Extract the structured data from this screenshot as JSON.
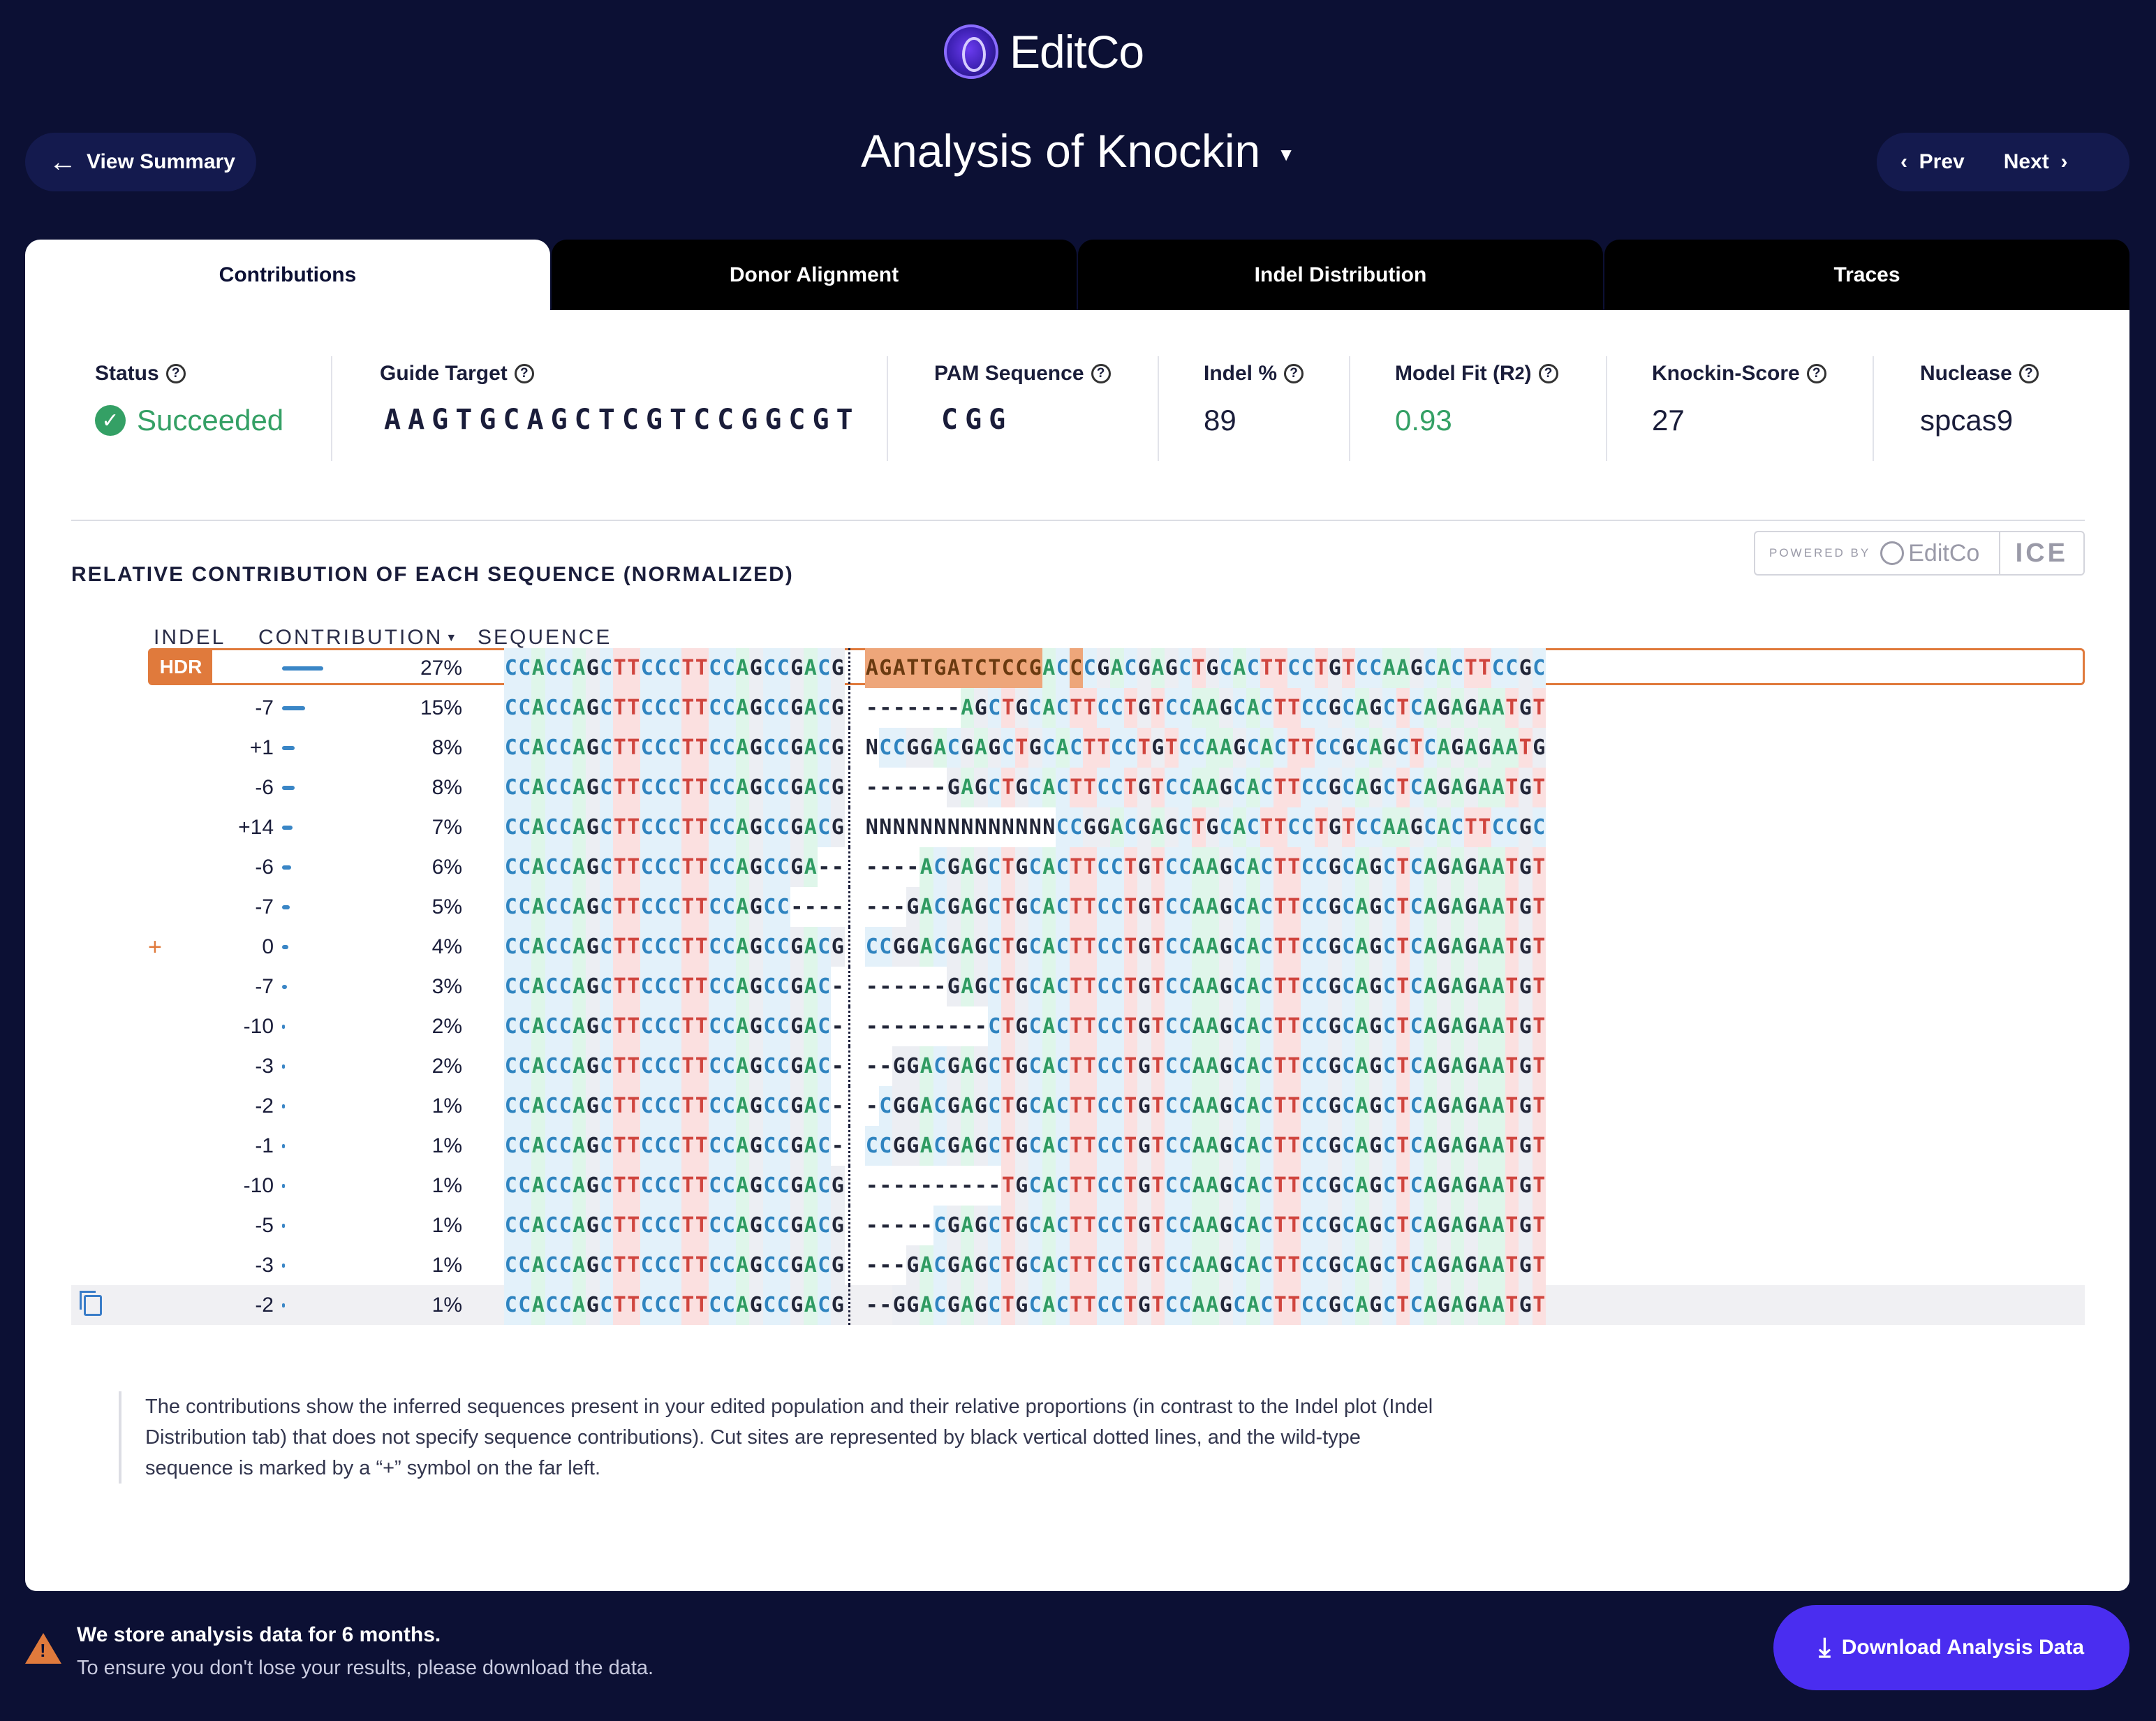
{
  "brand": {
    "name": "EditCo"
  },
  "header": {
    "title": "Analysis of Knockin",
    "view_summary": "View Summary",
    "prev": "Prev",
    "next": "Next"
  },
  "tabs": [
    {
      "label": "Contributions",
      "active": true
    },
    {
      "label": "Donor Alignment",
      "active": false
    },
    {
      "label": "Indel Distribution",
      "active": false
    },
    {
      "label": "Traces",
      "active": false
    }
  ],
  "stats": {
    "status": {
      "label": "Status",
      "value": "Succeeded"
    },
    "guide_target": {
      "label": "Guide Target",
      "value": "AAGTGCAGCTCGTCCGGCGT"
    },
    "pam": {
      "label": "PAM Sequence",
      "value": "CGG"
    },
    "indel_pct": {
      "label": "Indel %",
      "value": "89"
    },
    "model_fit": {
      "label": "Model Fit (R",
      "sup": "2",
      "label_end": ")",
      "value": "0.93"
    },
    "knockin_score": {
      "label": "Knockin-Score",
      "value": "27"
    },
    "nuclease": {
      "label": "Nuclease",
      "value": "spcas9"
    }
  },
  "section_title": "RELATIVE CONTRIBUTION OF EACH SEQUENCE (NORMALIZED)",
  "powered_by": {
    "label": "POWERED BY",
    "brand": "EditCo",
    "product": "ICE"
  },
  "columns": {
    "indel": "INDEL",
    "contribution": "CONTRIBUTION",
    "sequence": "SEQUENCE"
  },
  "rows": [
    {
      "indel": "HDR",
      "pct": "27%",
      "frac": 0.27,
      "left": "CCACCAGCTTCCCTTCCAGCCGACG",
      "right": "AGATTGATCTCCGACCCGACGAGCTGCACTTCCTGTCCAAGCACTTCCGC",
      "hdr": true
    },
    {
      "indel": "-7",
      "pct": "15%",
      "frac": 0.15,
      "left": "CCACCAGCTTCCCTTCCAGCCGACG",
      "right": "-------AGCTGCACTTCCTGTCCAAGCACTTCCGCAGCTCAGAGAATGT"
    },
    {
      "indel": "+1",
      "pct": "8%",
      "frac": 0.08,
      "left": "CCACCAGCTTCCCTTCCAGCCGACG",
      "right": "NCCGGACGAGCTGCACTTCCTGTCCAAGCACTTCCGCAGCTCAGAGAATG"
    },
    {
      "indel": "-6",
      "pct": "8%",
      "frac": 0.08,
      "left": "CCACCAGCTTCCCTTCCAGCCGACG",
      "right": "------GAGCTGCACTTCCTGTCCAAGCACTTCCGCAGCTCAGAGAATGT"
    },
    {
      "indel": "+14",
      "pct": "7%",
      "frac": 0.07,
      "left": "CCACCAGCTTCCCTTCCAGCCGACG",
      "right": "NNNNNNNNNNNNNNCCGGACGAGCTGCACTTCCTGTCCAAGCACTTCCGC"
    },
    {
      "indel": "-6",
      "pct": "6%",
      "frac": 0.06,
      "left": "CCACCAGCTTCCCTTCCAGCCGA--",
      "right": "----ACGAGCTGCACTTCCTGTCCAAGCACTTCCGCAGCTCAGAGAATGT"
    },
    {
      "indel": "-7",
      "pct": "5%",
      "frac": 0.05,
      "left": "CCACCAGCTTCCCTTCCAGCC----",
      "right": "---GACGAGCTGCACTTCCTGTCCAAGCACTTCCGCAGCTCAGAGAATGT"
    },
    {
      "indel": "0",
      "pct": "4%",
      "frac": 0.04,
      "left": "CCACCAGCTTCCCTTCCAGCCGACG",
      "right": "CCGGACGAGCTGCACTTCCTGTCCAAGCACTTCCGCAGCTCAGAGAATGT",
      "wt": true
    },
    {
      "indel": "-7",
      "pct": "3%",
      "frac": 0.03,
      "left": "CCACCAGCTTCCCTTCCAGCCGAC-",
      "right": "------GAGCTGCACTTCCTGTCCAAGCACTTCCGCAGCTCAGAGAATGT"
    },
    {
      "indel": "-10",
      "pct": "2%",
      "frac": 0.02,
      "left": "CCACCAGCTTCCCTTCCAGCCGAC-",
      "right": "---------CTGCACTTCCTGTCCAAGCACTTCCGCAGCTCAGAGAATGT"
    },
    {
      "indel": "-3",
      "pct": "2%",
      "frac": 0.02,
      "left": "CCACCAGCTTCCCTTCCAGCCGAC-",
      "right": "--GGACGAGCTGCACTTCCTGTCCAAGCACTTCCGCAGCTCAGAGAATGT"
    },
    {
      "indel": "-2",
      "pct": "1%",
      "frac": 0.01,
      "left": "CCACCAGCTTCCCTTCCAGCCGAC-",
      "right": "-CGGACGAGCTGCACTTCCTGTCCAAGCACTTCCGCAGCTCAGAGAATGT"
    },
    {
      "indel": "-1",
      "pct": "1%",
      "frac": 0.01,
      "left": "CCACCAGCTTCCCTTCCAGCCGAC-",
      "right": "CCGGACGAGCTGCACTTCCTGTCCAAGCACTTCCGCAGCTCAGAGAATGT"
    },
    {
      "indel": "-10",
      "pct": "1%",
      "frac": 0.01,
      "left": "CCACCAGCTTCCCTTCCAGCCGACG",
      "right": "----------TGCACTTCCTGTCCAAGCACTTCCGCAGCTCAGAGAATGT"
    },
    {
      "indel": "-5",
      "pct": "1%",
      "frac": 0.01,
      "left": "CCACCAGCTTCCCTTCCAGCCGACG",
      "right": "-----CGAGCTGCACTTCCTGTCCAAGCACTTCCGCAGCTCAGAGAATGT"
    },
    {
      "indel": "-3",
      "pct": "1%",
      "frac": 0.01,
      "left": "CCACCAGCTTCCCTTCCAGCCGACG",
      "right": "---GACGAGCTGCACTTCCTGTCCAAGCACTTCCGCAGCTCAGAGAATGT"
    },
    {
      "indel": "-2",
      "pct": "1%",
      "frac": 0.01,
      "left": "CCACCAGCTTCCCTTCCAGCCGACG",
      "right": "--GGACGAGCTGCACTTCCTGTCCAAGCACTTCCGCAGCTCAGAGAATGT",
      "copy": true
    }
  ],
  "hdr_highlight_count": 13,
  "note": "The contributions show the inferred sequences present in your edited population and their relative proportions (in contrast to the Indel plot (Indel Distribution tab) that does not specify sequence contributions). Cut sites are represented by black vertical dotted lines, and the wild-type sequence is marked by a “+” symbol on the far left.",
  "wt_marker": "+",
  "footer": {
    "warning_title": "We store analysis data for 6 months.",
    "warning_text": "To ensure you don't lose your results, please download the data.",
    "download": "Download Analysis Data"
  },
  "colors": {
    "A": "#2f9b62",
    "C": "#2f84c0",
    "G": "#222638",
    "T": "#d0453e",
    "hdr": "#e07a3c",
    "accent": "#4a2df0"
  }
}
